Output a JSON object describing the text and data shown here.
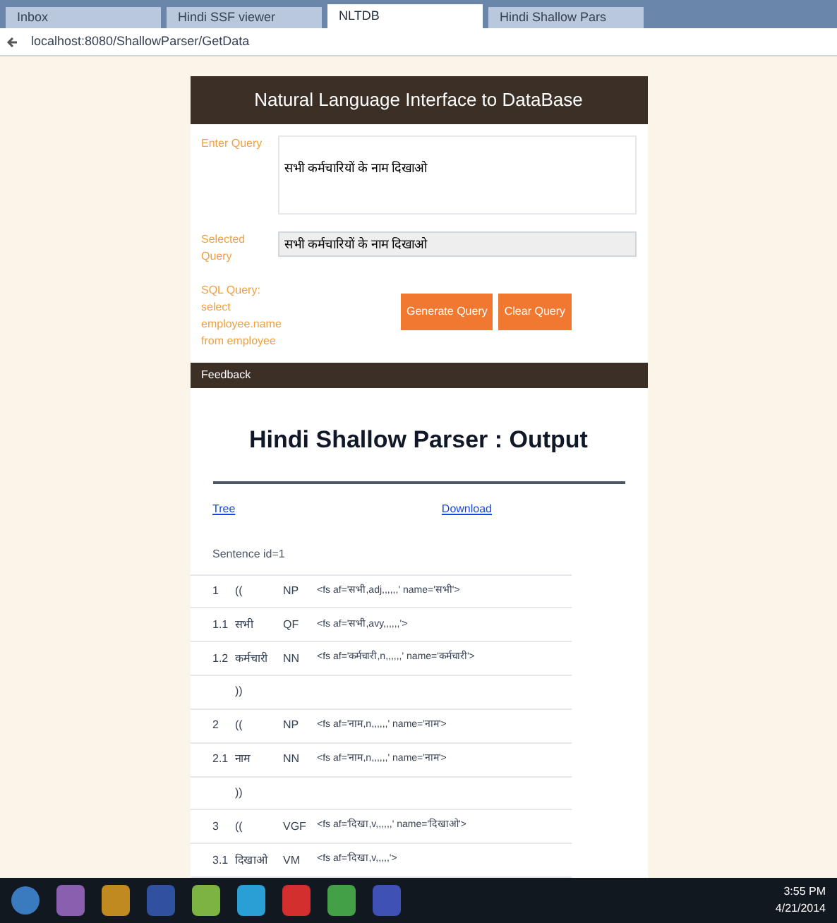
{
  "browser": {
    "tabs": [
      {
        "label": "Inbox",
        "selected": false
      },
      {
        "label": "Hindi SSF viewer",
        "selected": false
      },
      {
        "label": "NLTDB",
        "selected": true
      },
      {
        "label": "Hindi Shallow Pars",
        "selected": false
      }
    ],
    "address": "localhost:8080/ShallowParser/GetData"
  },
  "header": {
    "title": "Natural Language Interface to DataBase"
  },
  "form": {
    "query_label": "Enter Query",
    "query_value": "सभी कर्मचारियों के नाम दिखाओ",
    "selected_label": "Selected Query",
    "selected_value": "सभी कर्मचारियों के नाम दिखाओ",
    "sql_label": "SQL Query: select employee.name from employee",
    "buttons": [
      "Generate Query",
      "Clear Query"
    ]
  },
  "feedback_bar": {
    "title": "Feedback"
  },
  "output": {
    "title": "Hindi Shallow Parser : Output",
    "links": [
      "Tree",
      "Download"
    ],
    "sentence": "Sentence id=1",
    "rows": [
      {
        "col_1": "1",
        "col_2": "((",
        "col_3": "NP",
        "col_4": "<fs af='सभी,adj,,,,,,' name='सभी'>"
      },
      {
        "col_1": "1.1",
        "col_2": "सभी",
        "col_3": "QF",
        "col_4": "<fs af='सभी,avy,,,,,,'>"
      },
      {
        "col_1": "1.2",
        "col_2": "कर्मचारी",
        "col_3": "NN",
        "col_4": "<fs af='कर्मचारी,n,,,,,,' name='कर्मचारी'>"
      },
      {
        "col_1": "",
        "col_2": "))",
        "col_3": "",
        "col_4": ""
      },
      {
        "col_1": "2",
        "col_2": "((",
        "col_3": "NP",
        "col_4": "<fs af='नाम,n,,,,,,' name='नाम'>"
      },
      {
        "col_1": "2.1",
        "col_2": "नाम",
        "col_3": "NN",
        "col_4": "<fs af='नाम,n,,,,,,' name='नाम'>"
      },
      {
        "col_1": "",
        "col_2": "))",
        "col_3": "",
        "col_4": ""
      },
      {
        "col_1": "3",
        "col_2": "((",
        "col_3": "VGF",
        "col_4": "<fs af='दिखा,v,,,,,,' name='दिखाओ'>"
      },
      {
        "col_1": "3.1",
        "col_2": "दिखाओ",
        "col_3": "VM",
        "col_4": "<fs af='दिखा,v,,,,,'>"
      }
    ]
  },
  "taskbar": {
    "time": "3:55 PM",
    "date": "4/21/2014"
  }
}
